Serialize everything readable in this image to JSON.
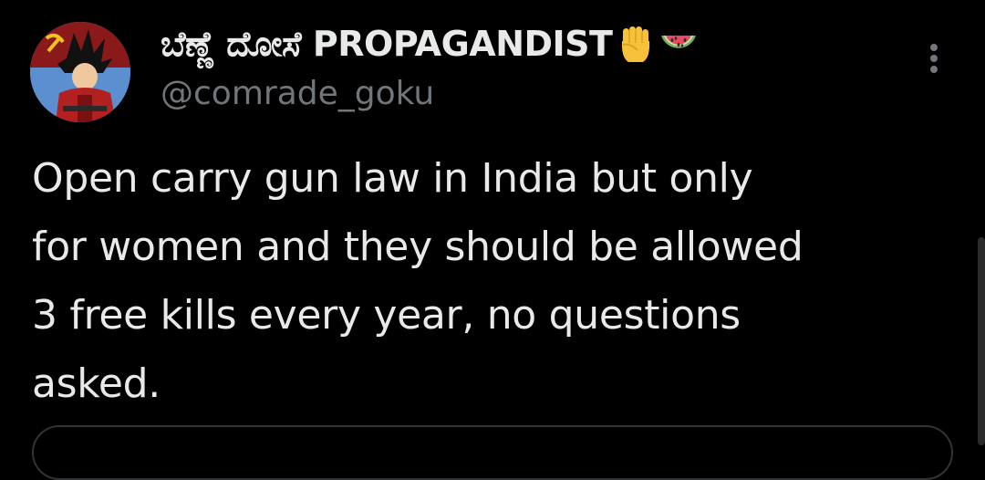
{
  "tweet": {
    "display_name": "ಬೆಣ್ಣೆ ದೋಸೆ PROPAGANDIST",
    "emojis": [
      "raised-fist-icon",
      "watermelon-icon"
    ],
    "handle": "@comrade_goku",
    "text": "Open carry gun law in India but only\nfor women and they should be allowed\n3 free kills every year, no questions\nasked."
  },
  "colors": {
    "background": "#000000",
    "primary_text": "#e7e9ea",
    "secondary_text": "#71767b",
    "border": "#2f3336"
  }
}
